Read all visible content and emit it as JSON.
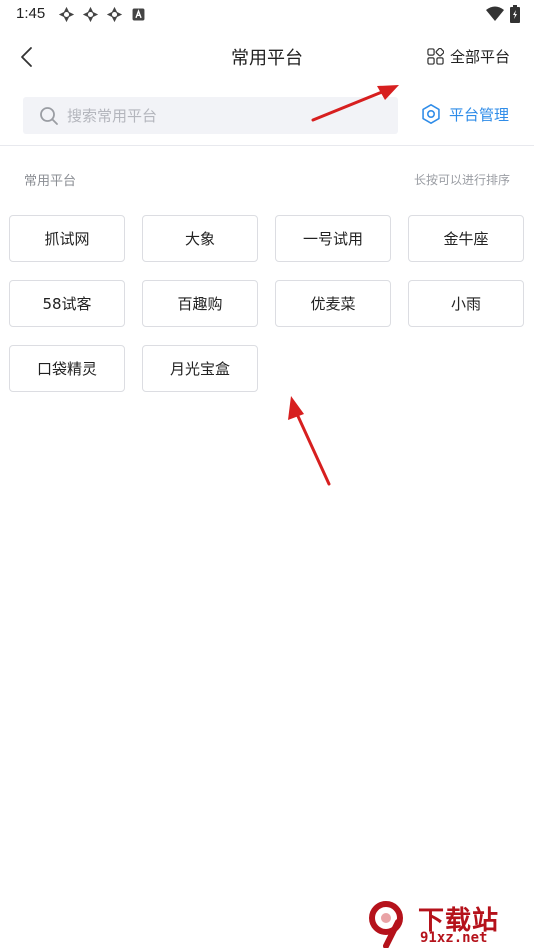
{
  "status_bar": {
    "time": "1:45",
    "notification_icons": [
      "app-icon",
      "app-icon",
      "app-icon",
      "a-icon"
    ],
    "right_icons": [
      "wifi-icon",
      "battery-icon"
    ]
  },
  "header": {
    "back_icon": "chevron-left-icon",
    "title": "常用平台",
    "all_platforms_label": "全部平台",
    "all_platforms_icon": "grid-icon"
  },
  "search": {
    "placeholder": "搜索常用平台",
    "value": "",
    "icon": "search-icon"
  },
  "manage": {
    "label": "平台管理",
    "icon": "gear-icon",
    "color": "#2f8ce8"
  },
  "section": {
    "title": "常用平台",
    "hint": "长按可以进行排序"
  },
  "platforms": [
    {
      "label": "抓试网"
    },
    {
      "label": "大象"
    },
    {
      "label": "一号试用"
    },
    {
      "label": "金牛座"
    },
    {
      "label": "58试客"
    },
    {
      "label": "百趣购"
    },
    {
      "label": "优麦菜"
    },
    {
      "label": "小雨"
    },
    {
      "label": "口袋精灵"
    },
    {
      "label": "月光宝盒"
    }
  ],
  "annotation": {
    "arrow_color": "#d71f1f"
  },
  "watermark": {
    "brand": "下载站",
    "domain": "91xz.net",
    "color": "#b5121b"
  }
}
